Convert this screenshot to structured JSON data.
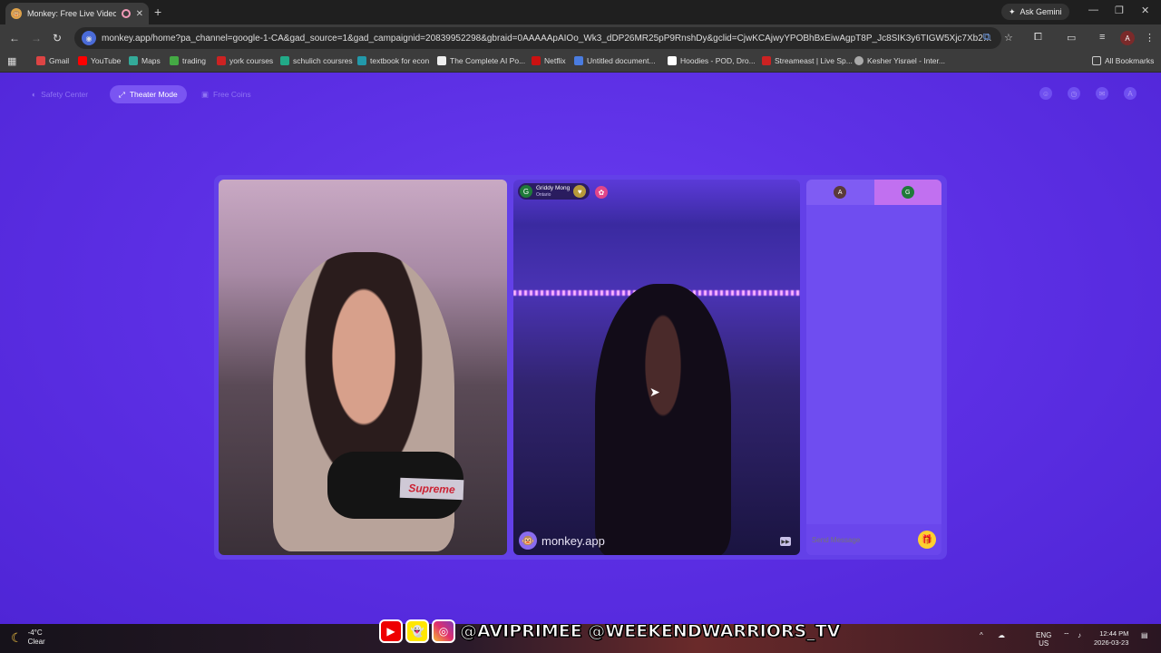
{
  "browser": {
    "tab_title": "Monkey: Free Live Video Ch",
    "ask_gemini": "Ask Gemini",
    "url": "monkey.app/home?pa_channel=google-1-CA&gad_source=1&gad_campaignid=20839952298&gbraid=0AAAAApAIOo_Wk3_dDP26MR25pP9RnshDy&gclid=CjwKCAjwyYPOBhBxEiwAgpT8P_Jc8SIK3y6TIGW5Xjc7Xb26mijgwvyV0ohsFYY...",
    "profile_initial": "A",
    "bookmarks": [
      "Gmail",
      "YouTube",
      "Maps",
      "trading",
      "york courses",
      "schulich coursres",
      "textbook for econ",
      "The Complete AI Po...",
      "Netflix",
      "Untitled document...",
      "Hoodies - POD, Dro...",
      "Streameast | Live Sp...",
      "Kesher Yisrael - Inter..."
    ],
    "all_bookmarks": "All Bookmarks"
  },
  "page": {
    "nav": {
      "safety_center": "Safety Center",
      "theater_mode": "Theater Mode",
      "free_coins": "Free Coins",
      "avatar_initial": "A"
    },
    "remote_user": {
      "name": "Griddy Mong",
      "location": "Ontario",
      "initial": "G"
    },
    "brand_watermark": "monkey.app",
    "chat": {
      "left_initial": "A",
      "right_initial": "G",
      "placeholder": "Send Message"
    }
  },
  "overlay": {
    "handles": "@AVIPRIMEE @WEEKENDWARRIORS_TV"
  },
  "taskbar": {
    "temperature": "-4°C",
    "condition": "Clear",
    "lang_top": "ENG",
    "lang_bottom": "US",
    "time": "12:44 PM",
    "date": "2026-03-23"
  }
}
